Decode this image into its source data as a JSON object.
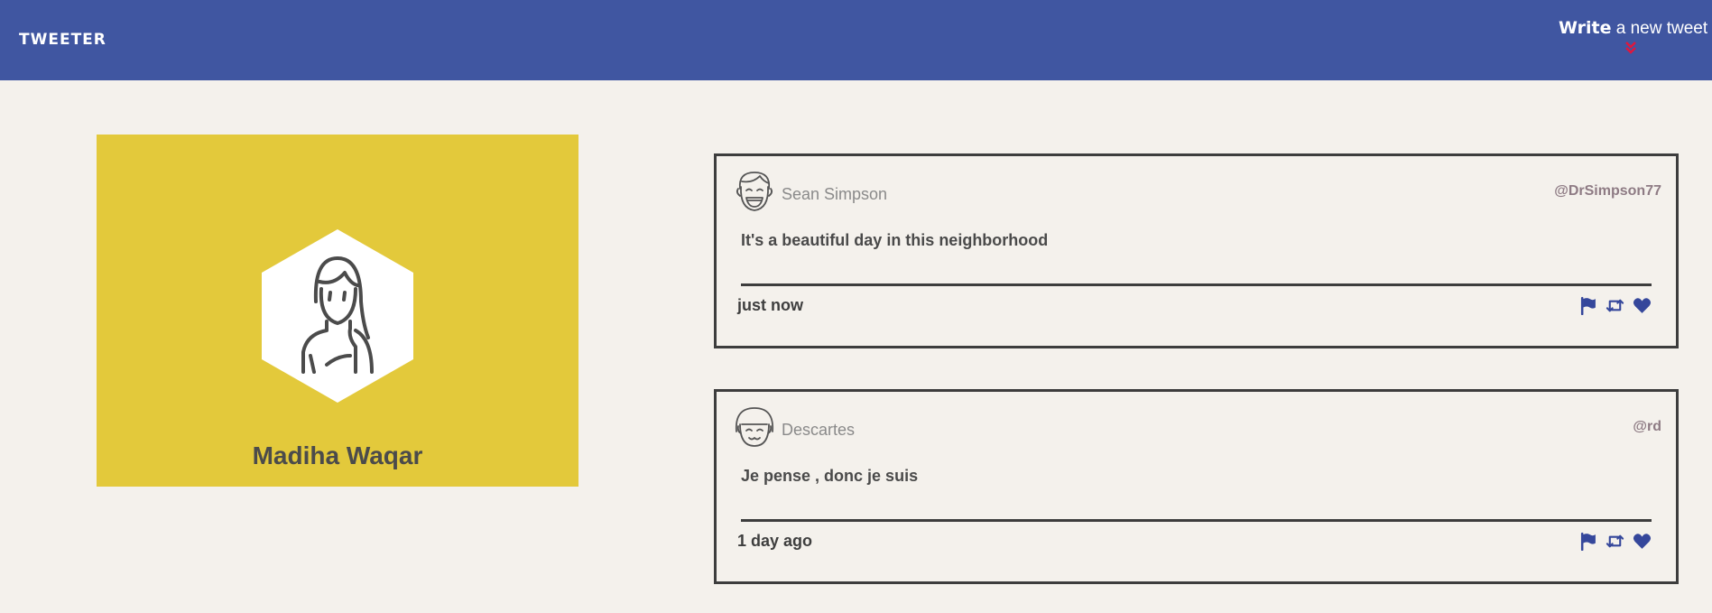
{
  "nav": {
    "brand": "TWEETER",
    "compose_bold": "Write",
    "compose_rest": " a new tweet",
    "compose_icon": "double-chevron-down-icon",
    "compose_icon_color": "#e0173d",
    "background": "#4056a1"
  },
  "profile": {
    "name": "Madiha Waqar",
    "avatar_icon": "woman-avatar-icon",
    "background": "#e3c93b"
  },
  "tweets": [
    {
      "name": "Sean Simpson",
      "handle": "@DrSimpson77",
      "avatar_icon": "laughing-man-avatar-icon",
      "content": "It's a beautiful day in this neighborhood",
      "time": "just now",
      "actions": [
        "flag-icon",
        "retweet-icon",
        "heart-icon"
      ]
    },
    {
      "name": "Descartes",
      "handle": "@rd",
      "avatar_icon": "smiling-person-avatar-icon",
      "content": "Je pense , donc je suis",
      "time": "1 day ago",
      "actions": [
        "flag-icon",
        "retweet-icon",
        "heart-icon"
      ]
    }
  ],
  "colors": {
    "page_background": "#f4f1ec",
    "action_icon": "#35479b"
  }
}
